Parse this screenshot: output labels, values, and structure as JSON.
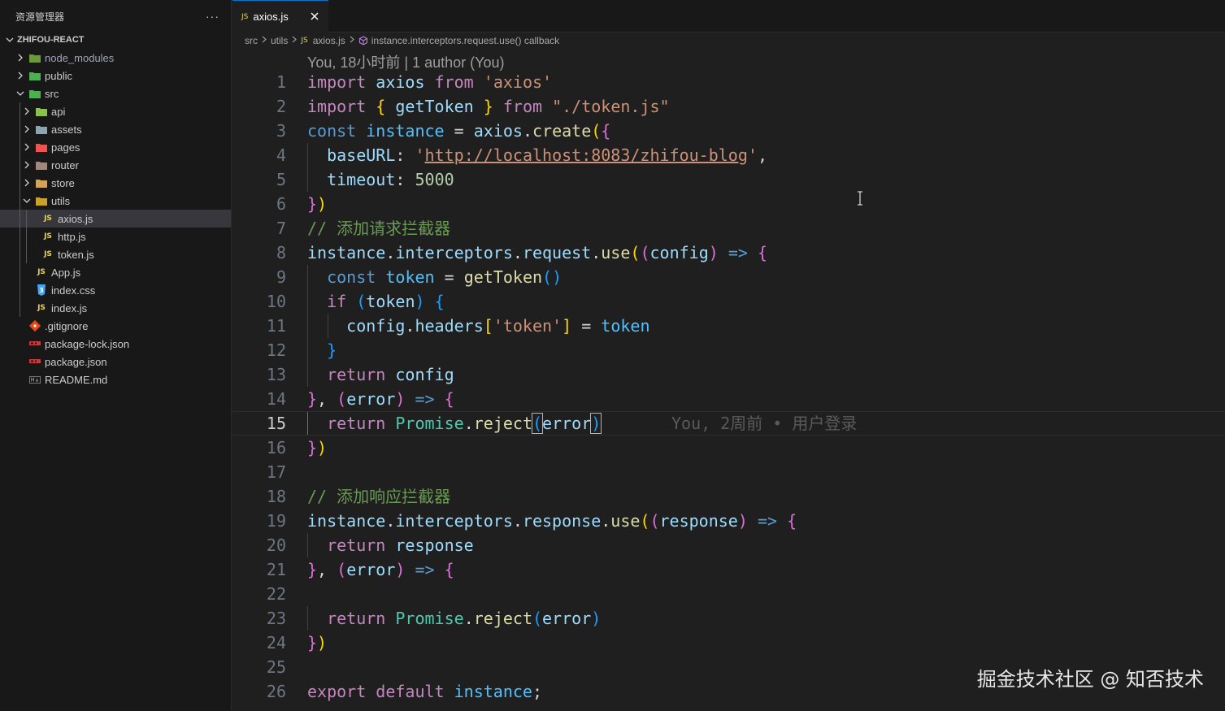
{
  "sidebar": {
    "title": "资源管理器",
    "more": "···",
    "project": "ZHIFOU-REACT",
    "items": [
      {
        "label": "node_modules",
        "icon": "folder-node-icon"
      },
      {
        "label": "public",
        "icon": "folder-public-icon"
      },
      {
        "label": "src",
        "icon": "folder-src-icon"
      },
      {
        "label": "api",
        "icon": "folder-api-icon"
      },
      {
        "label": "assets",
        "icon": "folder-assets-icon"
      },
      {
        "label": "pages",
        "icon": "folder-pages-icon"
      },
      {
        "label": "router",
        "icon": "folder-router-icon"
      },
      {
        "label": "store",
        "icon": "folder-store-icon"
      },
      {
        "label": "utils",
        "icon": "folder-utils-icon"
      },
      {
        "label": "axios.js",
        "icon": "js-file-icon"
      },
      {
        "label": "http.js",
        "icon": "js-file-icon"
      },
      {
        "label": "token.js",
        "icon": "js-file-icon"
      },
      {
        "label": "App.js",
        "icon": "js-file-icon"
      },
      {
        "label": "index.css",
        "icon": "css-file-icon"
      },
      {
        "label": "index.js",
        "icon": "js-file-icon"
      },
      {
        "label": ".gitignore",
        "icon": "git-icon"
      },
      {
        "label": "package-lock.json",
        "icon": "npm-icon"
      },
      {
        "label": "package.json",
        "icon": "npm-icon"
      },
      {
        "label": "README.md",
        "icon": "markdown-icon"
      }
    ],
    "js_badge": "JS"
  },
  "tab": {
    "label": "axios.js",
    "icon": "JS"
  },
  "breadcrumb": {
    "src": "src",
    "utils": "utils",
    "file": "axios.js",
    "symbol": "instance.interceptors.request.use() callback"
  },
  "editor": {
    "codelens": "You, 18小时前 | 1 author (You)",
    "blame": "You, 2周前 • 用户登录",
    "active_line": 15
  },
  "watermark": "掘金技术社区 @ 知否技术",
  "colors": {
    "accent": "#0078d4",
    "keyword": "#c586c0",
    "string": "#ce9178",
    "comment": "#6a9955"
  }
}
